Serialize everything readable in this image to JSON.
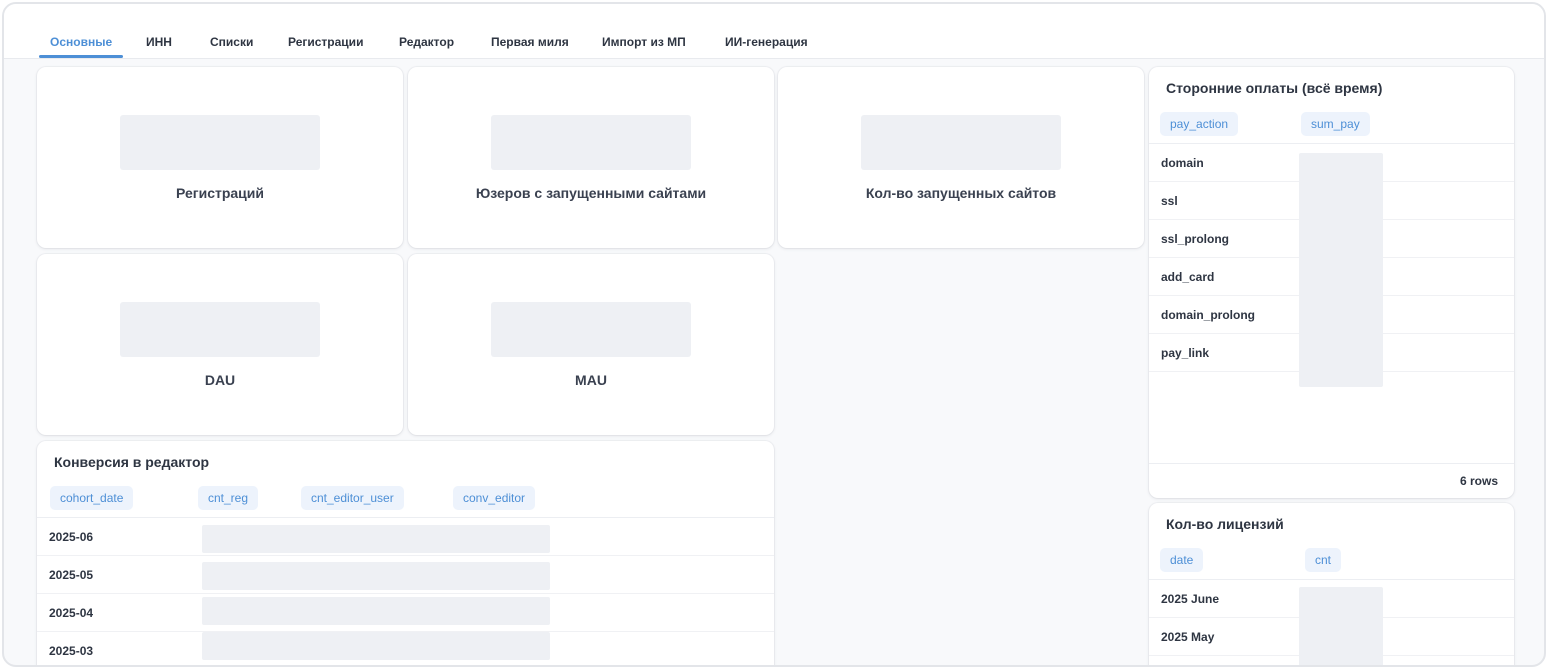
{
  "tabs": [
    {
      "label": "Основные",
      "active": true
    },
    {
      "label": "ИНН",
      "active": false
    },
    {
      "label": "Списки",
      "active": false
    },
    {
      "label": "Регистрации",
      "active": false
    },
    {
      "label": "Редактор",
      "active": false
    },
    {
      "label": "Первая миля",
      "active": false
    },
    {
      "label": "Импорт из МП",
      "active": false
    },
    {
      "label": "ИИ-генерация",
      "active": false
    }
  ],
  "scalars": {
    "registrations": "Регистраций",
    "users_with_sites": "Юзеров с запущенными сайтами",
    "sites_launched": "Кол-во запущенных сайтов",
    "dau": "DAU",
    "mau": "MAU"
  },
  "third_party_payments": {
    "title": "Сторонние оплаты (всё время)",
    "columns": [
      "pay_action",
      "sum_pay"
    ],
    "rows": [
      "domain",
      "ssl",
      "ssl_prolong",
      "add_card",
      "domain_prolong",
      "pay_link"
    ],
    "rows_count": "6 rows"
  },
  "editor_conversion": {
    "title": "Конверсия в редактор",
    "columns": [
      "cohort_date",
      "cnt_reg",
      "cnt_editor_user",
      "conv_editor"
    ],
    "rows": [
      "2025-06",
      "2025-05",
      "2025-04",
      "2025-03"
    ]
  },
  "licenses": {
    "title": "Кол-во лицензий",
    "columns": [
      "date",
      "cnt"
    ],
    "rows": [
      "2025 June",
      "2025 May"
    ]
  },
  "colors": {
    "accent": "#4d8fd6",
    "text": "#2e3542",
    "header_chip_bg": "#edf3fc",
    "redacted": "#eef0f4",
    "canvas": "#f8f9fb"
  }
}
